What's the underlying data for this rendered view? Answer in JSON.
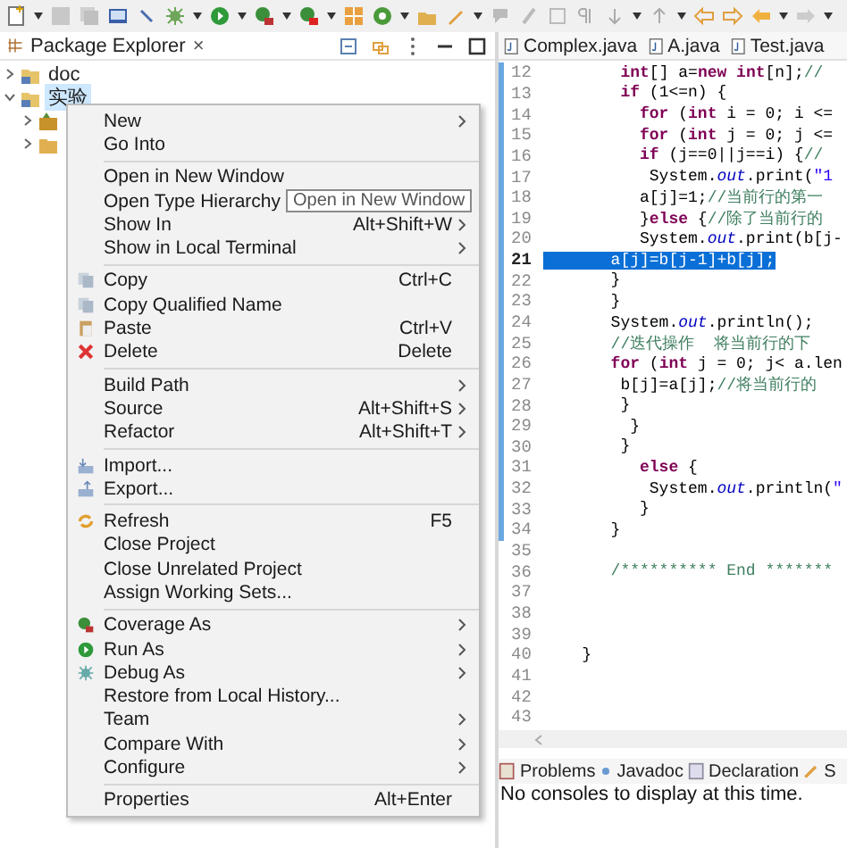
{
  "explorer": {
    "title": "Package Explorer",
    "close": "×",
    "tree": [
      {
        "label": "doc",
        "kind": "project",
        "expanded": false,
        "selected": false
      },
      {
        "label": "实验",
        "kind": "project",
        "expanded": true,
        "selected": true,
        "children": [
          {
            "kind": "package",
            "expanded": false
          },
          {
            "kind": "folder",
            "expanded": false
          }
        ]
      }
    ]
  },
  "context_menu": [
    {
      "kind": "item",
      "label": "New",
      "arrow": true
    },
    {
      "kind": "item",
      "label": "Go Into"
    },
    {
      "kind": "separator"
    },
    {
      "kind": "item",
      "label": "Open in New Window"
    },
    {
      "kind": "item",
      "label": "Open Type Hierarchy"
    },
    {
      "kind": "item",
      "label": "Show In",
      "shortcut": "Alt+Shift+W",
      "arrow": true
    },
    {
      "kind": "item",
      "label": "Show in Local Terminal",
      "arrow": true
    },
    {
      "kind": "separator"
    },
    {
      "kind": "item",
      "label": "Copy",
      "shortcut": "Ctrl+C"
    },
    {
      "kind": "item",
      "label": "Copy Qualified Name"
    },
    {
      "kind": "item",
      "label": "Paste",
      "shortcut": "Ctrl+V"
    },
    {
      "kind": "item",
      "label": "Delete",
      "shortcut": "Delete"
    },
    {
      "kind": "separator"
    },
    {
      "kind": "item",
      "label": "Build Path",
      "arrow": true
    },
    {
      "kind": "item",
      "label": "Source",
      "shortcut": "Alt+Shift+S",
      "arrow": true
    },
    {
      "kind": "item",
      "label": "Refactor",
      "shortcut": "Alt+Shift+T",
      "arrow": true
    },
    {
      "kind": "separator"
    },
    {
      "kind": "item",
      "label": "Import..."
    },
    {
      "kind": "item",
      "label": "Export..."
    },
    {
      "kind": "separator"
    },
    {
      "kind": "item",
      "label": "Refresh",
      "shortcut": "F5"
    },
    {
      "kind": "item",
      "label": "Close Project"
    },
    {
      "kind": "item",
      "label": "Close Unrelated Project"
    },
    {
      "kind": "item",
      "label": "Assign Working Sets..."
    },
    {
      "kind": "separator"
    },
    {
      "kind": "item",
      "label": "Coverage As",
      "arrow": true
    },
    {
      "kind": "item",
      "label": "Run As",
      "arrow": true
    },
    {
      "kind": "item",
      "label": "Debug As",
      "arrow": true
    },
    {
      "kind": "item",
      "label": "Restore from Local History..."
    },
    {
      "kind": "item",
      "label": "Team",
      "arrow": true
    },
    {
      "kind": "item",
      "label": "Compare With",
      "arrow": true
    },
    {
      "kind": "item",
      "label": "Configure",
      "arrow": true
    },
    {
      "kind": "separator"
    },
    {
      "kind": "item",
      "label": "Properties",
      "shortcut": "Alt+Enter"
    }
  ],
  "tooltip": "Open in New Window",
  "editor_tabs": [
    {
      "label": "Complex.java"
    },
    {
      "label": "A.java"
    },
    {
      "label": "Test.java"
    }
  ],
  "code_lines": [
    {
      "n": "12",
      "selected": false,
      "parts": [
        {
          "kind": "keyword",
          "t": "        int"
        },
        {
          "kind": "plain",
          "t": "[] a="
        },
        {
          "kind": "keyword",
          "t": "new int"
        },
        {
          "kind": "plain",
          "t": "[n];"
        },
        {
          "kind": "comment",
          "t": "//"
        }
      ]
    },
    {
      "n": "13",
      "selected": false,
      "parts": [
        {
          "kind": "keyword",
          "t": "        if"
        },
        {
          "kind": "plain",
          "t": " (1<=n) {"
        }
      ]
    },
    {
      "n": "14",
      "selected": false,
      "parts": [
        {
          "kind": "keyword",
          "t": "          for"
        },
        {
          "kind": "plain",
          "t": " ("
        },
        {
          "kind": "keyword",
          "t": "int"
        },
        {
          "kind": "plain",
          "t": " i = 0; i <="
        }
      ]
    },
    {
      "n": "15",
      "selected": false,
      "parts": [
        {
          "kind": "keyword",
          "t": "          for"
        },
        {
          "kind": "plain",
          "t": " ("
        },
        {
          "kind": "keyword",
          "t": "int"
        },
        {
          "kind": "plain",
          "t": " j = 0; j <="
        }
      ]
    },
    {
      "n": "16",
      "selected": false,
      "parts": [
        {
          "kind": "keyword",
          "t": "          if"
        },
        {
          "kind": "plain",
          "t": " (j==0||j==i) {"
        },
        {
          "kind": "comment",
          "t": "//"
        }
      ]
    },
    {
      "n": "17",
      "selected": false,
      "parts": [
        {
          "kind": "plain",
          "t": "           System."
        },
        {
          "kind": "field",
          "t": "out"
        },
        {
          "kind": "plain",
          "t": ".print("
        },
        {
          "kind": "string",
          "t": "\"1"
        }
      ]
    },
    {
      "n": "18",
      "selected": false,
      "parts": [
        {
          "kind": "plain",
          "t": "          a[j]=1;"
        },
        {
          "kind": "comment",
          "t": "//当前行的第一"
        }
      ]
    },
    {
      "n": "19",
      "selected": false,
      "parts": [
        {
          "kind": "plain",
          "t": "          }"
        },
        {
          "kind": "keyword",
          "t": "else"
        },
        {
          "kind": "plain",
          "t": " {"
        },
        {
          "kind": "comment",
          "t": "//除了当前行的"
        }
      ]
    },
    {
      "n": "20",
      "selected": false,
      "parts": [
        {
          "kind": "plain",
          "t": "          System."
        },
        {
          "kind": "field",
          "t": "out"
        },
        {
          "kind": "plain",
          "t": ".print(b[j-"
        }
      ]
    },
    {
      "n": "21",
      "selected": true,
      "parts": [
        {
          "kind": "plain",
          "t": "       a[j]=b[j-1]+b[j];"
        }
      ]
    },
    {
      "n": "22",
      "selected": false,
      "parts": [
        {
          "kind": "plain",
          "t": "       }"
        }
      ]
    },
    {
      "n": "23",
      "selected": false,
      "parts": [
        {
          "kind": "plain",
          "t": "       }"
        }
      ]
    },
    {
      "n": "24",
      "selected": false,
      "parts": [
        {
          "kind": "plain",
          "t": "       System."
        },
        {
          "kind": "field",
          "t": "out"
        },
        {
          "kind": "plain",
          "t": ".println();"
        }
      ]
    },
    {
      "n": "25",
      "selected": false,
      "parts": [
        {
          "kind": "comment",
          "t": "       //迭代操作  将当前行的下"
        }
      ]
    },
    {
      "n": "26",
      "selected": false,
      "parts": [
        {
          "kind": "keyword",
          "t": "       for"
        },
        {
          "kind": "plain",
          "t": " ("
        },
        {
          "kind": "keyword",
          "t": "int"
        },
        {
          "kind": "plain",
          "t": " j = 0; j< a.len"
        }
      ]
    },
    {
      "n": "27",
      "selected": false,
      "parts": [
        {
          "kind": "plain",
          "t": "        b[j]=a[j];"
        },
        {
          "kind": "comment",
          "t": "//将当前行的"
        }
      ]
    },
    {
      "n": "28",
      "selected": false,
      "parts": [
        {
          "kind": "plain",
          "t": "        }"
        }
      ]
    },
    {
      "n": "29",
      "selected": false,
      "parts": [
        {
          "kind": "plain",
          "t": "         }"
        }
      ]
    },
    {
      "n": "30",
      "selected": false,
      "parts": [
        {
          "kind": "plain",
          "t": "        }"
        }
      ]
    },
    {
      "n": "31",
      "selected": false,
      "parts": [
        {
          "kind": "keyword",
          "t": "          else"
        },
        {
          "kind": "plain",
          "t": " {"
        }
      ]
    },
    {
      "n": "32",
      "selected": false,
      "parts": [
        {
          "kind": "plain",
          "t": "           System."
        },
        {
          "kind": "field",
          "t": "out"
        },
        {
          "kind": "plain",
          "t": ".println("
        },
        {
          "kind": "string",
          "t": "\""
        }
      ]
    },
    {
      "n": "33",
      "selected": false,
      "parts": [
        {
          "kind": "plain",
          "t": "          }"
        }
      ]
    },
    {
      "n": "34",
      "selected": false,
      "parts": [
        {
          "kind": "plain",
          "t": "       }"
        }
      ]
    },
    {
      "n": "35",
      "selected": false
    },
    {
      "n": "36",
      "selected": false,
      "parts": [
        {
          "kind": "comment",
          "t": "       /********** End *******"
        }
      ]
    },
    {
      "n": "37",
      "selected": false
    },
    {
      "n": "38",
      "selected": false
    },
    {
      "n": "39",
      "selected": false
    },
    {
      "n": "40",
      "selected": false,
      "parts": [
        {
          "kind": "plain",
          "t": "    }"
        }
      ]
    },
    {
      "n": "41",
      "selected": false
    },
    {
      "n": "42",
      "selected": false
    },
    {
      "n": "43",
      "selected": false
    }
  ],
  "bottom_tabs": [
    {
      "label": "Problems"
    },
    {
      "label": "Javadoc"
    },
    {
      "label": "Declaration"
    },
    {
      "label": "S"
    }
  ],
  "console_message": "No consoles to display at this time."
}
